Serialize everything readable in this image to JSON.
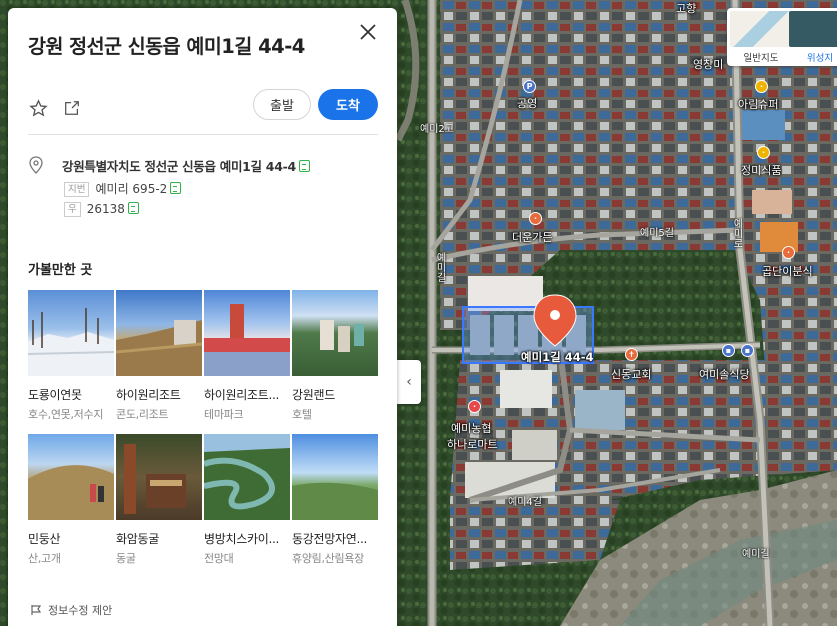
{
  "place": {
    "title": "강원 정선군 신동읍 예미1길 44-4",
    "road_address": "강원특별자치도 정선군 신동읍 예미1길 44-4",
    "jibun_tag": "지번",
    "jibun": "예미리 695-2",
    "postal_tag": "우",
    "postal": "26138"
  },
  "actions": {
    "depart_label": "출발",
    "arrive_label": "도착",
    "star_icon": "star-icon",
    "share_icon": "share-icon",
    "close_icon": "close-icon"
  },
  "nearby": {
    "section_title": "가볼만한 곳",
    "items": [
      {
        "name": "도룡이연못",
        "category": "호수,연못,저수지"
      },
      {
        "name": "하이원리조트",
        "category": "콘도,리조트"
      },
      {
        "name": "하이원리조트...",
        "category": "테마파크"
      },
      {
        "name": "강원랜드",
        "category": "호텔"
      },
      {
        "name": "민둥산",
        "category": "산,고개"
      },
      {
        "name": "화암동굴",
        "category": "동굴"
      },
      {
        "name": "병방치스카이...",
        "category": "전망대"
      },
      {
        "name": "동강전망자연...",
        "category": "휴양림,산림욕장"
      }
    ]
  },
  "footer": {
    "suggest_label": "정보수정 제안"
  },
  "map": {
    "type_toggle": [
      {
        "label": "일반지도",
        "active": false
      },
      {
        "label": "위성지",
        "active": true
      }
    ],
    "marker_label": "예미1길 44-4",
    "labels": {
      "yeongchang": "영창미",
      "arim": "아림슈퍼",
      "jeongmi": "정미식품",
      "gongyeong": "공영",
      "deoun": "더운가든",
      "goldan": "곱단이분식",
      "sindong": "신동교회",
      "yeomi_sol": "여미솔식당",
      "nonghyup1": "예미농협",
      "nonghyup2": "하나로마트",
      "gonghwa": "고향...",
      "top_partial": "고향"
    },
    "roads": {
      "yemi2": "예미2고",
      "yemi_gil_v": "예미길",
      "yemi5gil": "예미5길",
      "yemiro_v": "예미로",
      "yemi4gil": "예미4길",
      "yemi_gil2": "예미길"
    },
    "colors": {
      "marker": "#e85a3c",
      "highlight": "#3a78ff",
      "accent": "#1a73e8"
    }
  }
}
